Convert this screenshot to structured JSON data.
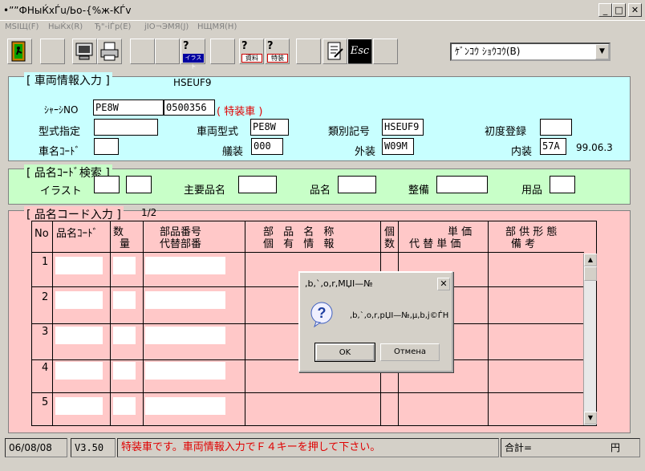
{
  "window": {
    "title": "•””ФНыЌxЃu/Ьo-{%ж-KЃv"
  },
  "menu": [
    "МЅIЩ(F)",
    "НыЌх(R)",
    "Ђ\"-iЃp(E)",
    "јIO¬ЭМЯ(J)",
    "НЩМЯ(H)"
  ],
  "toolbar": {
    "buttons": [
      {
        "name": "exit-icon",
        "label": ""
      },
      {
        "name": "blank",
        "label": ""
      },
      {
        "name": "monitor-icon",
        "label": ""
      },
      {
        "name": "printer-icon",
        "label": ""
      },
      {
        "name": "blank",
        "label": ""
      },
      {
        "name": "blank",
        "label": ""
      },
      {
        "name": "illust-help-icon",
        "label": "イラスト"
      },
      {
        "name": "blank",
        "label": ""
      },
      {
        "name": "material-help-icon",
        "label": "資料"
      },
      {
        "name": "special-help-icon",
        "label": "特装"
      },
      {
        "name": "blank",
        "label": ""
      },
      {
        "name": "document-icon",
        "label": ""
      },
      {
        "name": "escape-icon",
        "label": "Esc"
      },
      {
        "name": "blank",
        "label": ""
      }
    ],
    "combo_value": "ｹﾞﾝｺｳ ｼｮｳｺｳ(B)"
  },
  "vehicle": {
    "group_label": "[ 車両情報入力 ]",
    "model_code": "HSEUF9",
    "chassis_label": "ｼｬｰｼNO",
    "chassis_prefix": "PE8W",
    "chassis_number": "0500356",
    "special_note": "( 特装車 )",
    "type_spec_label": "型式指定",
    "type_spec_value": "",
    "vehicle_model_label": "車両型式",
    "vehicle_model_value": "PE8W",
    "class_label": "類別記号",
    "class_value": "HSEUF9",
    "first_reg_label": "初度登録",
    "first_reg_value": "",
    "car_code_label": "車名ｺｰﾄﾞ",
    "car_code_value": "",
    "equip_label": "艤装",
    "equip_value": "000",
    "exterior_label": "外装",
    "exterior_value": "W09M",
    "interior_label": "内装",
    "interior_value": "57A",
    "date_text": "99.06.3"
  },
  "search": {
    "group_label": "[ 品名ｺｰﾄﾞ検索 ]",
    "illust_label": "イラスト",
    "main_name_label": "主要品名",
    "name_label": "品名",
    "maintenance_label": "整備",
    "supplies_label": "用品"
  },
  "parts": {
    "group_label": "[ 品名コード入力 ]",
    "page": "1/2",
    "headers": {
      "no": "No",
      "code": "品名ｺｰﾄﾞ",
      "qty1": "数",
      "qty2": "量",
      "partno1": "部品番号",
      "partno2": "代替部番",
      "info1": "部 品 名 称",
      "info2": "個 有 情 報",
      "count1": "個",
      "count2": "数",
      "price1": "単 価",
      "price2": "代 替 単 価",
      "form1": "部 供 形 態",
      "form2": "備 考"
    },
    "rows": [
      "1",
      "2",
      "3",
      "4",
      "5"
    ]
  },
  "dialog": {
    "title": ",b,`,o,r,MЏI—№",
    "message": ",b,`,o,r,pЏI—№,µ,b,ј©ЃН",
    "ok": "OK",
    "cancel": "Отмена"
  },
  "status": {
    "date": "06/08/08",
    "version": "V3.50",
    "message": "特装車です。車両情報入力でＦ４キーを押して下さい。",
    "total_label": "合計=",
    "currency": "円"
  }
}
